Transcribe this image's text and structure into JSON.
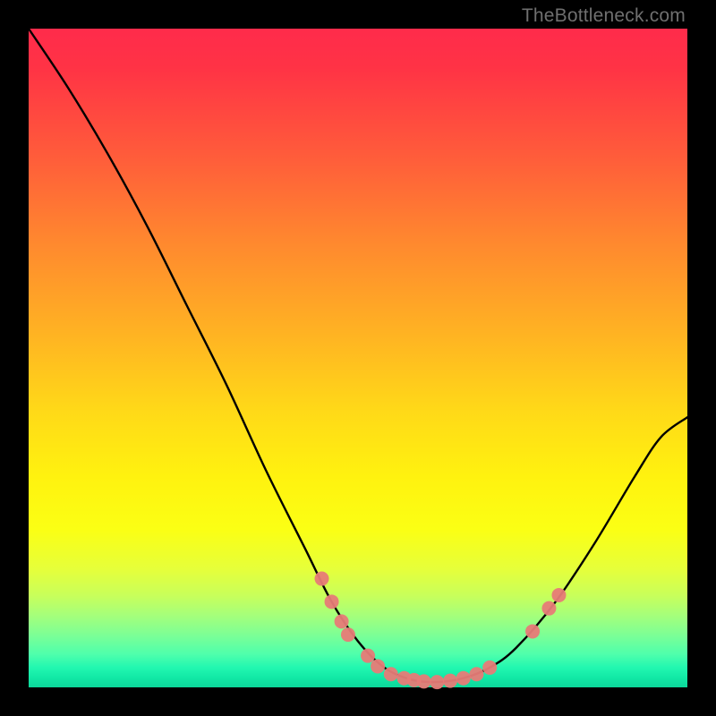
{
  "attribution": "TheBottleneck.com",
  "chart_data": {
    "type": "line",
    "title": "",
    "xlabel": "",
    "ylabel": "",
    "xlim": [
      0,
      100
    ],
    "ylim": [
      0,
      100
    ],
    "grid": false,
    "curve": {
      "name": "bottleneck-curve",
      "color": "#000000",
      "points": [
        {
          "x": 0.0,
          "y": 100.0
        },
        {
          "x": 6.0,
          "y": 91.0
        },
        {
          "x": 12.0,
          "y": 81.0
        },
        {
          "x": 18.0,
          "y": 70.0
        },
        {
          "x": 24.0,
          "y": 58.0
        },
        {
          "x": 30.0,
          "y": 46.0
        },
        {
          "x": 36.0,
          "y": 33.0
        },
        {
          "x": 42.0,
          "y": 21.0
        },
        {
          "x": 46.0,
          "y": 13.0
        },
        {
          "x": 50.0,
          "y": 7.0
        },
        {
          "x": 54.0,
          "y": 3.0
        },
        {
          "x": 58.0,
          "y": 1.2
        },
        {
          "x": 62.0,
          "y": 0.8
        },
        {
          "x": 66.0,
          "y": 1.4
        },
        {
          "x": 70.0,
          "y": 3.0
        },
        {
          "x": 74.0,
          "y": 6.0
        },
        {
          "x": 80.0,
          "y": 13.0
        },
        {
          "x": 86.0,
          "y": 22.0
        },
        {
          "x": 92.0,
          "y": 32.0
        },
        {
          "x": 96.0,
          "y": 38.0
        },
        {
          "x": 100.0,
          "y": 41.0
        }
      ]
    },
    "series": [
      {
        "name": "markers",
        "type": "scatter",
        "color": "#e77b77",
        "points": [
          {
            "x": 44.5,
            "y": 16.5
          },
          {
            "x": 46.0,
            "y": 13.0
          },
          {
            "x": 47.5,
            "y": 10.0
          },
          {
            "x": 48.5,
            "y": 8.0
          },
          {
            "x": 51.5,
            "y": 4.8
          },
          {
            "x": 53.0,
            "y": 3.2
          },
          {
            "x": 55.0,
            "y": 2.0
          },
          {
            "x": 57.0,
            "y": 1.4
          },
          {
            "x": 58.5,
            "y": 1.1
          },
          {
            "x": 60.0,
            "y": 0.9
          },
          {
            "x": 62.0,
            "y": 0.8
          },
          {
            "x": 64.0,
            "y": 1.0
          },
          {
            "x": 66.0,
            "y": 1.4
          },
          {
            "x": 68.0,
            "y": 2.0
          },
          {
            "x": 70.0,
            "y": 3.0
          },
          {
            "x": 76.5,
            "y": 8.5
          },
          {
            "x": 79.0,
            "y": 12.0
          },
          {
            "x": 80.5,
            "y": 14.0
          }
        ]
      }
    ]
  }
}
